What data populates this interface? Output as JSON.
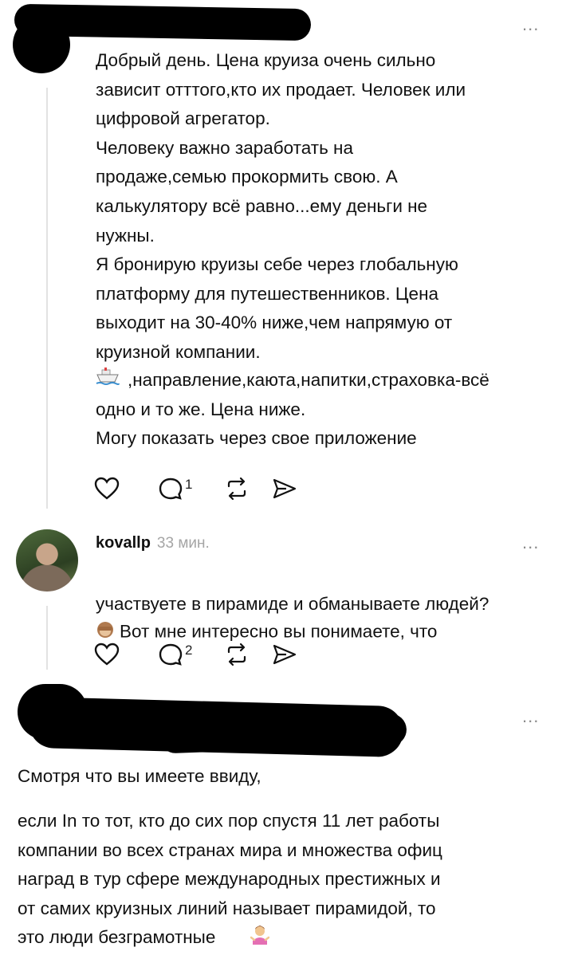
{
  "comment1": {
    "more": "...",
    "text": "Добрый день. Цена круиза очень сильно\nзависит отттого,кто их продает. Человек или\nцифровой агрегатор.\nЧеловеку важно заработать на\nпродаже,семью прокормить свою. А\nкалькулятору всё равно...ему деньги не\nнужны.\nЯ бронирую круизы себе через глобальную\nплатформу для путешественников. Цена\nвыходит на 30-40% ниже,чем напрямую от\nкруизной компании.",
    "text2": ",направление,каюта,напитки,страховка-всё\nодно и то же. Цена ниже.\nМогу показать через свое приложение",
    "reply_count": "1"
  },
  "comment2": {
    "username": "kovallp",
    "time": "33 мин.",
    "more": "...",
    "text_line1": "Вот мне интересно вы понимаете, что",
    "text_line2": "участвуете в пирамиде и обманываете людей?",
    "reply_count": "2"
  },
  "comment3": {
    "more": "...",
    "para1": "Смотря что вы имеете ввиду,",
    "para2": "если In то  тот, кто до сих пор спустя 11 лет работы\nкомпании во всех странах мира и множества офиц\nнаград в тур сфере международных престижных и\nот самих круизных линий называет пирамидой, то\nэто люди безграмотные"
  },
  "icons": {
    "like": "heart-icon",
    "reply": "comment-icon",
    "repost": "repost-icon",
    "share": "send-icon",
    "ship": "ship-emoji",
    "monkey": "see-no-evil-monkey-emoji",
    "shrug": "person-shrugging-emoji"
  }
}
